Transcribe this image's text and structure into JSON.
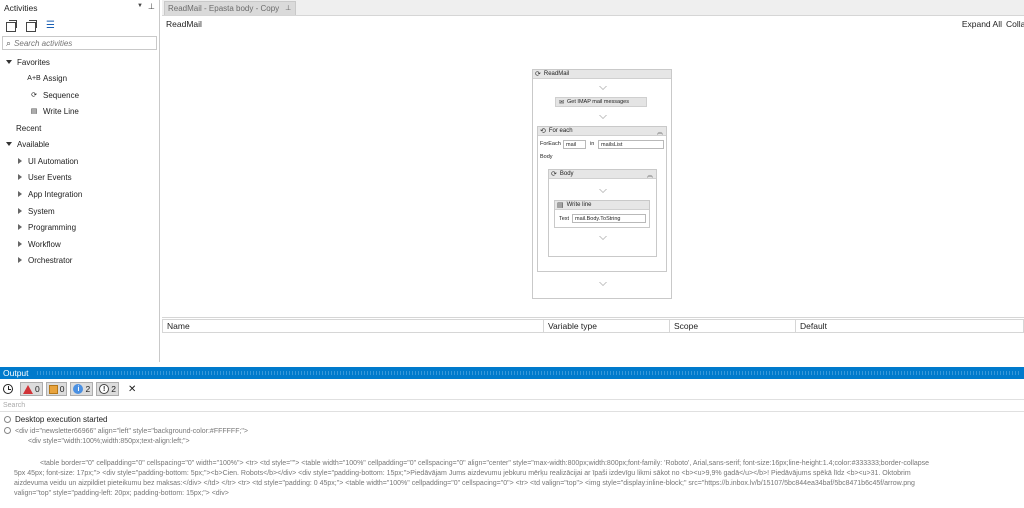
{
  "activities": {
    "title": "Activities",
    "search_placeholder": "Search activities",
    "favorites": {
      "label": "Favorites",
      "items": [
        {
          "label": "Assign",
          "icon": "assign-icon"
        },
        {
          "label": "Sequence",
          "icon": "sequence-icon"
        },
        {
          "label": "Write Line",
          "icon": "write-line-icon"
        }
      ]
    },
    "recent_label": "Recent",
    "available": {
      "label": "Available",
      "items": [
        "UI Automation",
        "User Events",
        "App Integration",
        "System",
        "Programming",
        "Workflow",
        "Orchestrator"
      ]
    }
  },
  "designer": {
    "tab_label": "ReadMail - Epasta body - Copy",
    "breadcrumb": "ReadMail",
    "expand_all": "Expand All",
    "collapse_all": "Collapse All",
    "workflow": {
      "root_title": "ReadMail",
      "get_mail_label": "Get IMAP mail messages",
      "foreach_title": "For each",
      "foreach_label": "ForEach",
      "item_var": "mail",
      "in_label": "in",
      "collection": "mailsList",
      "body_label": "Body",
      "body_seq_title": "Body",
      "write_line_title": "Write line",
      "text_label": "Text",
      "text_value": "mail.Body.ToString"
    }
  },
  "variables": {
    "columns": [
      "Name",
      "Variable type",
      "Scope",
      "Default"
    ]
  },
  "output": {
    "title": "Output",
    "filters": {
      "errors": "0",
      "warnings": "0",
      "info": "2",
      "trace": "2"
    },
    "search_placeholder": "Search",
    "log_lines": [
      "Desktop execution started",
      "<div id=\"newsletter66966\" align=\"left\" style=\"background-color:#FFFFFF;\">",
      "<div style=\"width:100%;width:850px;text-align:left;\">",
      "<table border=\"0\" cellpadding=\"0\" cellspacing=\"0\" width=\"100%\"> <tr> <td style=\"\"> <table width=\"100%\" cellpadding=\"0\" cellspacing=\"0\" align=\"center\" style=\"max-width:800px;width:800px;font-family: 'Roboto', Arial,sans-serif; font-size:16px;line-height:1.4;color:#333333;border-collapse",
      "5px 45px; font-size: 17px;\"> <div style=\"padding-bottom: 5px;\"><b>Cien. Robots</b></div> <div style=\"padding-bottom: 15px;\">Piedāvājam Jums aizdevumu jebkuru mērķu realizācijai ar īpaši izdevīgu likmi sākot no <b><u>9,9% gadā</u></b>! Piedāvājums spēkā līdz <b><u>31. Oktobrim",
      "aizdevuma veidu un aizpildiet pieteikumu bez maksas:</div> </td> </tr> <tr> <td style=\"padding: 0 45px;\"> <table width=\"100%\" cellpadding=\"0\" cellspacing=\"0\"> <tr> <td valign=\"top\"> <img style=\"display:inline-block;\" src=\"https://b.inbox.lv/b/15107/5bc844ea34baf/5bc8471b6c45f/arrow.png",
      "valign=\"top\" style=\"padding-left: 20px; padding-bottom: 15px;\"> <div>"
    ]
  },
  "colors": {
    "accent": "#007acc",
    "error": "#d13438",
    "warning": "#e8a33d",
    "info": "#4a90e2"
  }
}
